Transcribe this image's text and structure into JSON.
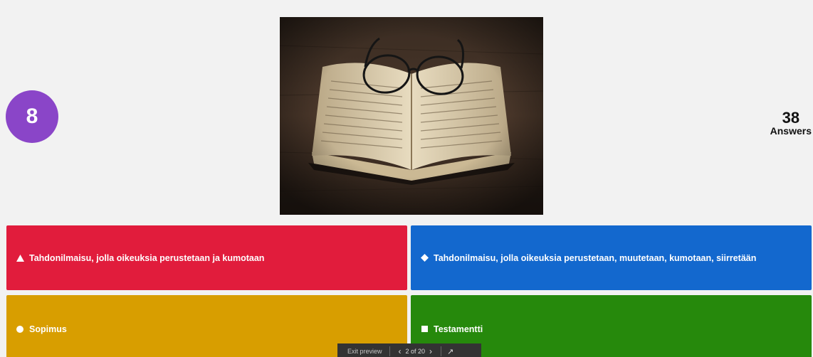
{
  "timer": {
    "value": "8",
    "color": "#8a45c8"
  },
  "answers_counter": {
    "count": "38",
    "label": "Answers"
  },
  "image": {
    "subject": "open-book-with-glasses"
  },
  "options": [
    {
      "shape": "triangle",
      "color": "#e11c3c",
      "text": "Tahdonilmaisu, jolla oikeuksia perustetaan ja kumotaan"
    },
    {
      "shape": "diamond",
      "color": "#1368ce",
      "text": "Tahdonilmaisu, jolla oikeuksia perustetaan, muutetaan, kumotaan, siirretään"
    },
    {
      "shape": "circle",
      "color": "#d89e00",
      "text": "Sopimus"
    },
    {
      "shape": "square",
      "color": "#26890c",
      "text": "Testamentti"
    }
  ],
  "preview_bar": {
    "exit_label": "Exit preview",
    "page_indicator": "2 of 20"
  }
}
